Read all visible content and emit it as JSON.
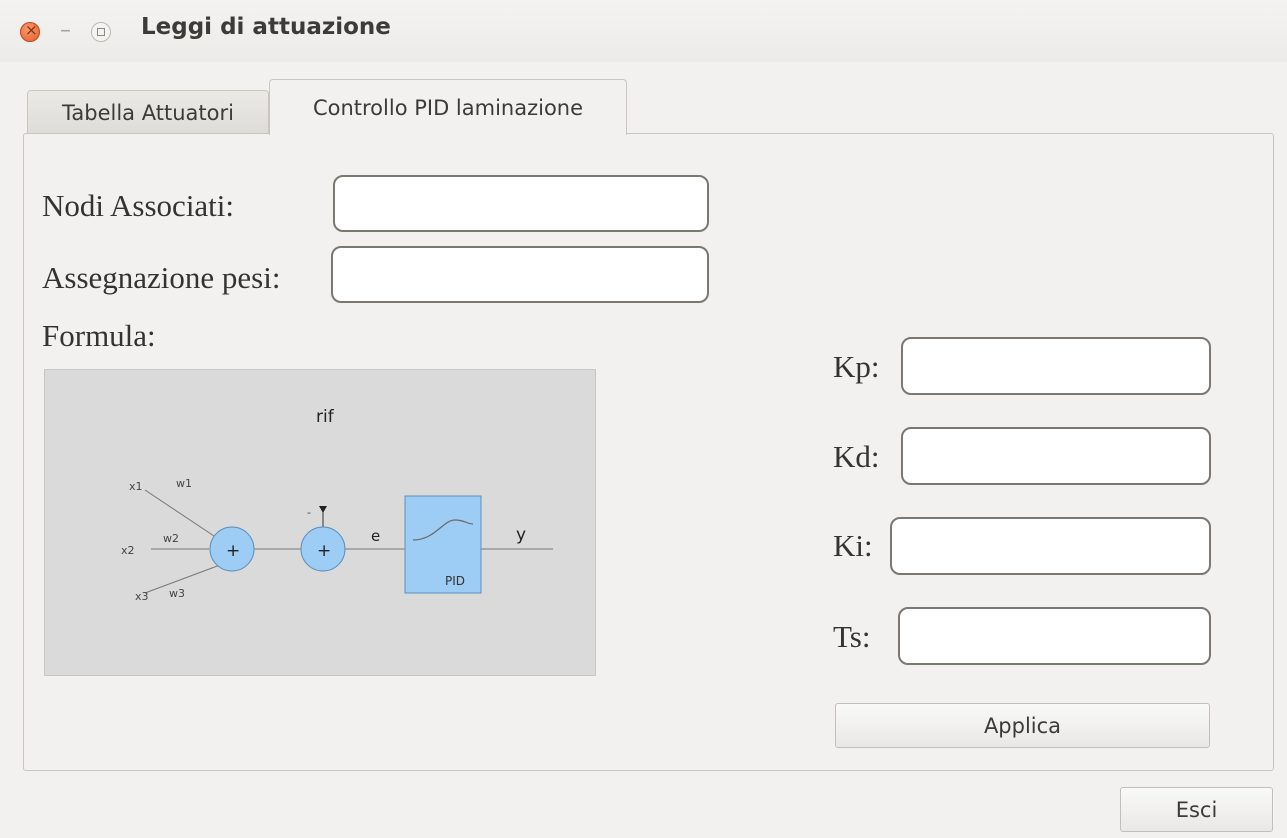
{
  "window": {
    "title": "Leggi di attuazione"
  },
  "tabs": [
    {
      "label": "Tabella Attuatori",
      "active": false
    },
    {
      "label": "Controllo PID laminazione",
      "active": true
    }
  ],
  "form": {
    "nodi_label": "Nodi Associati:",
    "nodi_value": "",
    "pesi_label": "Assegnazione pesi:",
    "pesi_value": "",
    "formula_label": "Formula:",
    "kp_label": "Kp:",
    "kp_value": "",
    "kd_label": "Kd:",
    "kd_value": "",
    "ki_label": "Ki:",
    "ki_value": "",
    "ts_label": "Ts:",
    "ts_value": "",
    "apply_label": "Applica"
  },
  "diagram": {
    "rif": "rif",
    "x1": "x1",
    "x2": "x2",
    "x3": "x3",
    "w1": "w1",
    "w2": "w2",
    "w3": "w3",
    "sum1": "+",
    "sum2": "+",
    "minus": "-",
    "e": "e",
    "pid": "PID",
    "y": "y"
  },
  "footer": {
    "exit_label": "Esci"
  },
  "colors": {
    "node_fill": "#9dccf5",
    "pid_fill": "#9dccf5",
    "close_button": "#e0582a"
  }
}
